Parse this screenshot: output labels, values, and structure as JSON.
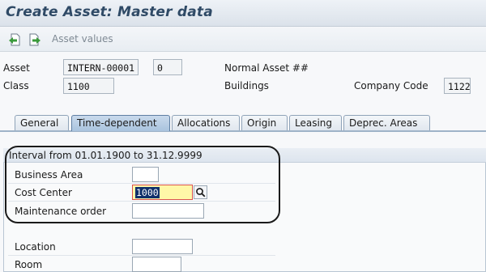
{
  "window": {
    "title": "Create Asset:  Master data"
  },
  "toolbar": {
    "asset_values_label": "Asset values"
  },
  "header": {
    "asset_label": "Asset",
    "asset_number": "INTERN-00001",
    "sub_number": "0",
    "asset_description": "Normal Asset ##",
    "class_label": "Class",
    "class_value": "1100",
    "class_description": "Buildings",
    "company_code_label": "Company Code",
    "company_code_value": "1122"
  },
  "tabs": [
    {
      "label": "General"
    },
    {
      "label": "Time-dependent"
    },
    {
      "label": "Allocations"
    },
    {
      "label": "Origin"
    },
    {
      "label": "Leasing"
    },
    {
      "label": "Deprec. Areas"
    }
  ],
  "active_tab": "Time-dependent",
  "interval_group": {
    "title": "Interval from 01.01.1900 to 31.12.9999",
    "business_area_label": "Business Area",
    "business_area_value": "",
    "cost_center_label": "Cost Center",
    "cost_center_value": "1000",
    "maintenance_order_label": "Maintenance order",
    "maintenance_order_value": ""
  },
  "location_group": {
    "location_label": "Location",
    "location_value": "",
    "room_label": "Room",
    "room_value": ""
  },
  "colors": {
    "title_text": "#2f4a66",
    "active_field_bg": "#fff7a8",
    "selection_bg": "#10306a",
    "active_tab_bg": "#a9c3de"
  },
  "icons": [
    "back-document-icon",
    "forward-document-icon",
    "search-help-icon"
  ]
}
